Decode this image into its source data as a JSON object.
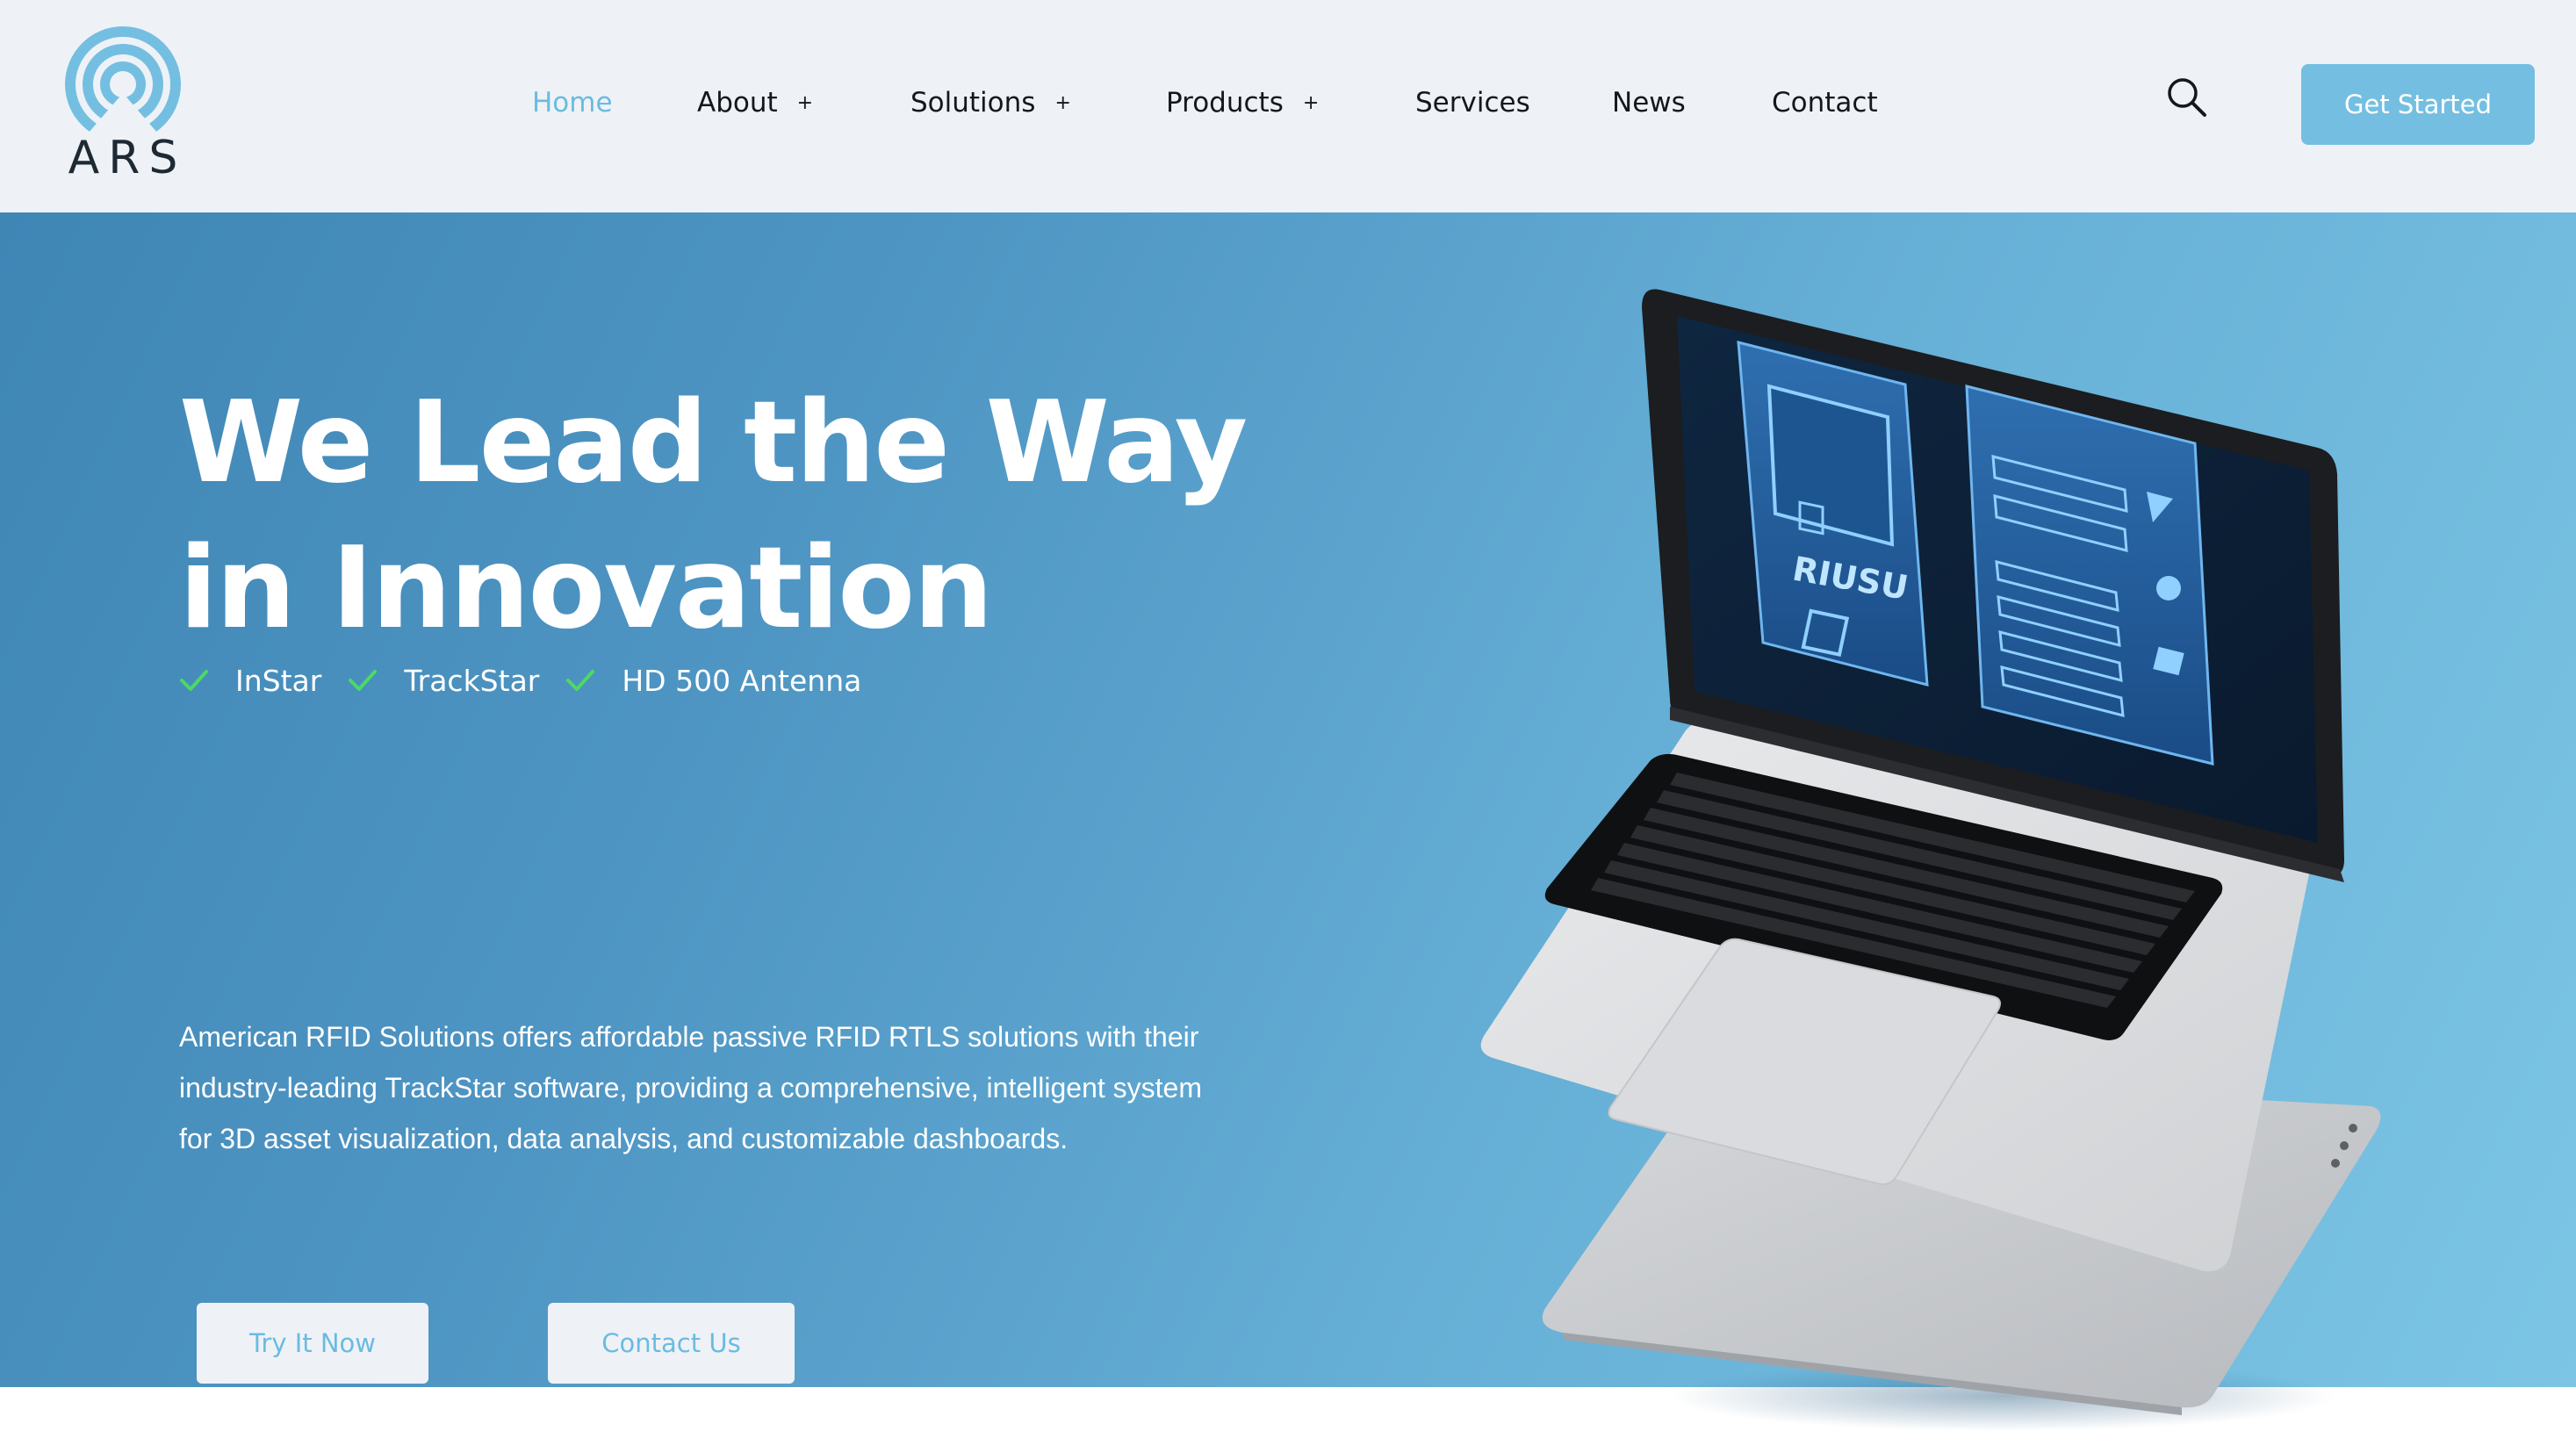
{
  "brand": {
    "logo_text": "ARS",
    "accent_color": "#74bfe1"
  },
  "nav": {
    "items": [
      {
        "label": "Home",
        "active": true,
        "has_submenu": false
      },
      {
        "label": "About",
        "has_submenu": true
      },
      {
        "label": "Solutions",
        "has_submenu": true
      },
      {
        "label": "Products",
        "has_submenu": true
      },
      {
        "label": "Services",
        "has_submenu": false
      },
      {
        "label": "News",
        "has_submenu": false
      },
      {
        "label": "Contact",
        "has_submenu": false
      }
    ],
    "submenu_glyph": "+",
    "search_icon": "search-icon",
    "cta_label": "Get Started"
  },
  "hero": {
    "title_line1": "We Lead the Way",
    "title_line2": "in Innovation",
    "products": [
      "InStar",
      "TrackStar",
      "HD 500 Antenna"
    ],
    "check_color": "#4cd964",
    "description": "American RFID Solutions offers affordable passive RFID RTLS solutions with their industry-leading TrackStar software, providing a comprehensive, intelligent system for 3D asset visualization, data analysis, and customizable dashboards.",
    "primary_button": "Try It Now",
    "secondary_button": "Contact Us",
    "screen_brand": "RIUSU"
  }
}
